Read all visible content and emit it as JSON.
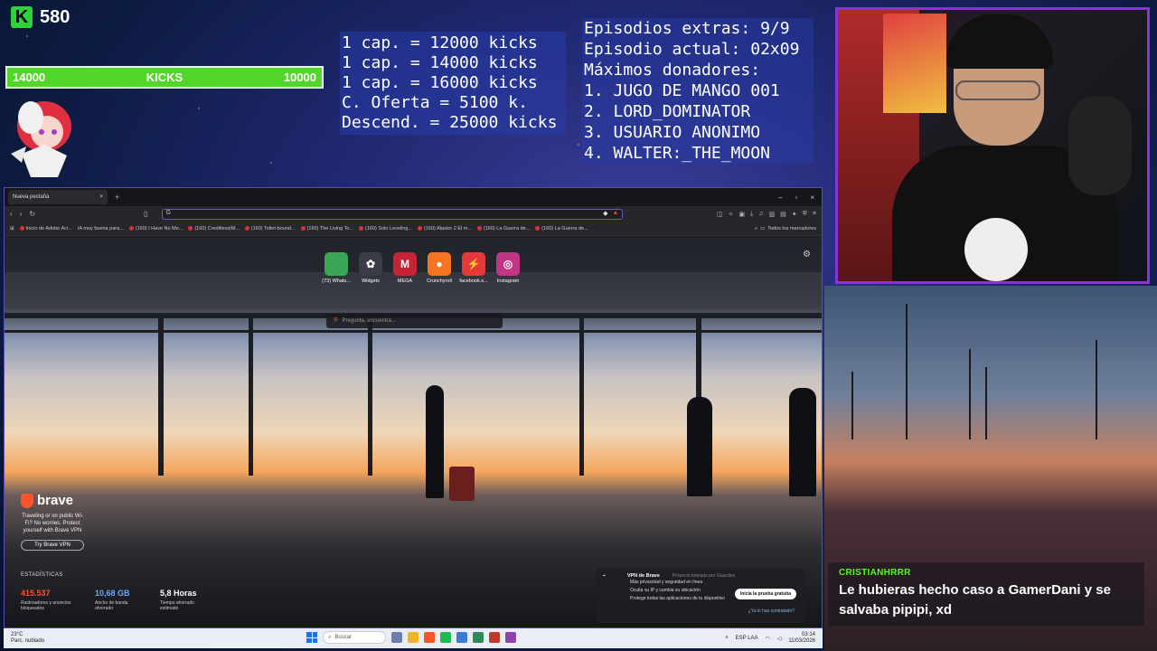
{
  "overlay": {
    "kick_count": "580",
    "kick_logo": "K",
    "bar": {
      "left": "14000",
      "center": "KICKS",
      "right": "10000",
      "fill_fraction": 1.0
    },
    "cap_lines": [
      "1 cap. = 12000 kicks",
      "1 cap. = 14000 kicks",
      "1 cap. = 16000 kicks",
      "C. Oferta = 5100 k.",
      "Descend. = 25000 kicks"
    ],
    "episode_lines": [
      "Episodios extras: 9/9",
      "Episodio actual: 02x09",
      "Máximos donadores:",
      "1. JUGO DE MANGO 001",
      "2. LORD_DOMINATOR",
      "3. USUARIO ANONIMO",
      "4. WALTER:_THE_MOON"
    ]
  },
  "chat": {
    "user": "CRISTIANHRRR",
    "message": "Le hubieras hecho caso a GamerDani y se salvaba pipipi, xd"
  },
  "browser": {
    "tab_title": "Nueva pestaña",
    "tab_close": "×",
    "new_tab": "+",
    "window_controls": [
      "–",
      "▫",
      "×"
    ],
    "bookmarks": [
      "Inicio de Adobe Acr...",
      "IA muy buena para...",
      "(160) I Have No Mo...",
      "(160) Creditless|M...",
      "(160) Toilet-bound...",
      "(160) The Living To...",
      "(160) Solo Leveling...",
      "(160) Alastor 2 El m...",
      "(160) La Guerra de...",
      "(160) La Guerra de..."
    ],
    "bookmarks_end": "Todos los marcadores",
    "speed_dials": [
      {
        "label": "(73) Whats...",
        "color": "#3aa655",
        "glyph": ""
      },
      {
        "label": "Widgets",
        "color": "#3c3c48",
        "glyph": "✿"
      },
      {
        "label": "MEGA",
        "color": "#c42434",
        "glyph": "M"
      },
      {
        "label": "Crunchyroll",
        "color": "#f47521",
        "glyph": "●"
      },
      {
        "label": "facebook.s...",
        "color": "#e23a3a",
        "glyph": "⚡"
      },
      {
        "label": "Instagram",
        "color": "#c13584",
        "glyph": "◎"
      }
    ],
    "search_placeholder": "Pregunta, encuentra...",
    "brave_name": "brave",
    "brave_promo": "Traveling or on public Wi-Fi? No worries. Protect yourself with Brave VPN",
    "brave_button": "Try Brave VPN",
    "stats_title": "ESTADÍSTICAS",
    "stats": [
      {
        "value": "415.537",
        "label": "Rastreadores y anuncios bloqueados",
        "color": "#fb542b"
      },
      {
        "value": "10,68 GB",
        "label": "Ancho de banda ahorrado",
        "color": "#6ea8ff"
      },
      {
        "value": "5,8 Horas",
        "label": "Tiempo ahorrado estimado",
        "color": "#ffffff"
      }
    ],
    "vpn_card": {
      "title": "VPN de Brave",
      "subtitle": "Proyecto tutelado por Guardian",
      "lines": [
        "Más privacidad y seguridad en línea",
        "Oculta su IP y cambia su ubicación",
        "Protege todas las aplicaciones de tu dispositivo"
      ],
      "cta": "Inicia la prueba gratuita",
      "link": "¿Ya lo has contratado?"
    }
  },
  "taskbar": {
    "weather_temp": "23°C",
    "weather_desc": "Parc. nublado",
    "search": "Buscar",
    "lang": "ESP LAA",
    "time": "03:14",
    "date": "11/03/2026"
  }
}
